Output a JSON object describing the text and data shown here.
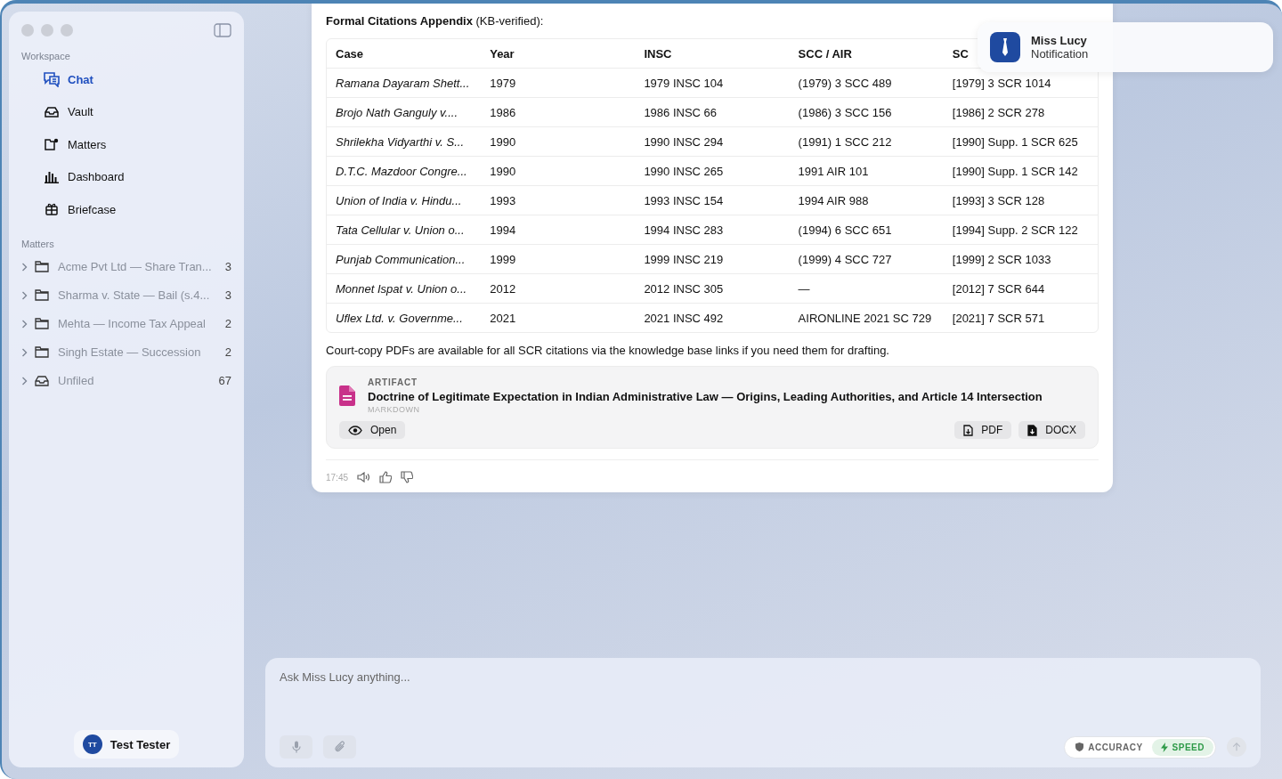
{
  "sidebar": {
    "section_workspace": "Workspace",
    "nav": [
      {
        "label": "Chat",
        "selected": true
      },
      {
        "label": "Vault",
        "selected": false
      },
      {
        "label": "Matters",
        "selected": false
      },
      {
        "label": "Dashboard",
        "selected": false
      },
      {
        "label": "Briefcase",
        "selected": false
      }
    ],
    "section_matters": "Matters",
    "matters": [
      {
        "name": "Acme Pvt Ltd — Share Tran...",
        "count": "3",
        "kind": "folder"
      },
      {
        "name": "Sharma v. State — Bail (s.4...",
        "count": "3",
        "kind": "folder"
      },
      {
        "name": "Mehta — Income Tax Appeal",
        "count": "2",
        "kind": "folder"
      },
      {
        "name": "Singh Estate — Succession",
        "count": "2",
        "kind": "folder"
      },
      {
        "name": "Unfiled",
        "count": "67",
        "kind": "inbox"
      }
    ],
    "user": {
      "initials": "TT",
      "name": "Test Tester"
    }
  },
  "message": {
    "heading": "**Formal Citations Appendix** (KB-verified):",
    "table": {
      "columns": [
        "Case",
        "Year",
        "INSC",
        "SCC / AIR",
        "SC"
      ],
      "rows": [
        [
          "Ramana Dayaram Shett...",
          "1979",
          "1979 INSC 104",
          "(1979) 3 SCC 489",
          "[1979] 3 SCR 1014"
        ],
        [
          "Brojo Nath Ganguly v....",
          "1986",
          "1986 INSC 66",
          "(1986) 3 SCC 156",
          "[1986] 2 SCR 278"
        ],
        [
          "Shrilekha Vidyarthi v. S...",
          "1990",
          "1990 INSC 294",
          "(1991) 1 SCC 212",
          "[1990] Supp. 1 SCR 625"
        ],
        [
          "D.T.C. Mazdoor Congre...",
          "1990",
          "1990 INSC 265",
          "1991 AIR 101",
          "[1990] Supp. 1 SCR 142"
        ],
        [
          "Union of India v. Hindu...",
          "1993",
          "1993 INSC 154",
          "1994 AIR 988",
          "[1993] 3 SCR 128"
        ],
        [
          "Tata Cellular v. Union o...",
          "1994",
          "1994 INSC 283",
          "(1994) 6 SCC 651",
          "[1994] Supp. 2 SCR 122"
        ],
        [
          "Punjab Communication...",
          "1999",
          "1999 INSC 219",
          "(1999) 4 SCC 727",
          "[1999] 2 SCR 1033"
        ],
        [
          "Monnet Ispat v. Union o...",
          "2012",
          "2012 INSC 305",
          "—",
          "[2012] 7 SCR 644"
        ],
        [
          "Uflex Ltd. v. Governme...",
          "2021",
          "2021 INSC 492",
          "AIRONLINE 2021 SC 729",
          "[2021] 7 SCR 571"
        ]
      ]
    },
    "note": "Court-copy PDFs are available for all SCR citations via the knowledge base links if you need them for drafting.",
    "artifact": {
      "label": "ARTIFACT",
      "title": "Doctrine of Legitimate Expectation in Indian Administrative Law — Origins, Leading Authorities, and Article 14 Intersection",
      "format": "MARKDOWN",
      "open": "Open",
      "downloads": [
        "PDF",
        "DOCX"
      ]
    },
    "time": "17:45"
  },
  "composer": {
    "placeholder": "Ask Miss Lucy anything...",
    "modes": [
      {
        "label": "ACCURACY",
        "kind": "shield",
        "selected": false
      },
      {
        "label": "SPEED",
        "kind": "bolt",
        "selected": true
      }
    ]
  },
  "notification": {
    "title": "Miss Lucy",
    "body": "Notification"
  }
}
